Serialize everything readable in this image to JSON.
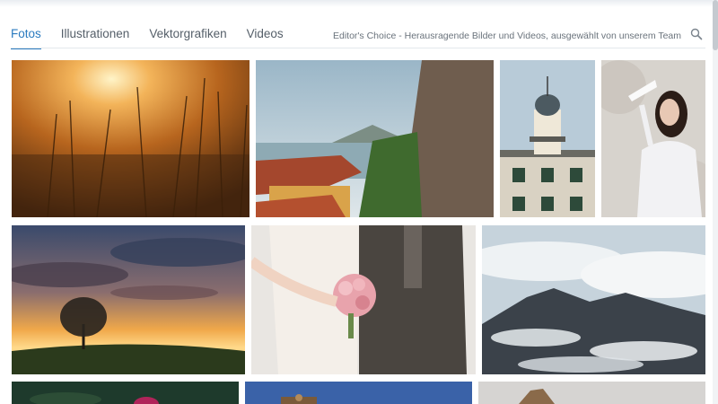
{
  "nav": {
    "tabs": [
      {
        "label": "Fotos",
        "active": true
      },
      {
        "label": "Illustrationen",
        "active": false
      },
      {
        "label": "Vektorgrafiken",
        "active": false
      },
      {
        "label": "Videos",
        "active": false
      }
    ],
    "editors_choice": "Editor's Choice - Herausragende Bilder und Videos, ausgewählt von unserem Team",
    "search_icon": "search-icon"
  },
  "colors": {
    "accent": "#2b7bbf",
    "text_muted": "#555f69"
  },
  "gallery": {
    "photos": [
      {
        "subject": "golden-grass-sunset"
      },
      {
        "subject": "lake-village-rooftops"
      },
      {
        "subject": "lighthouse-tower"
      },
      {
        "subject": "woman-with-feather"
      },
      {
        "subject": "lone-tree-sunset"
      },
      {
        "subject": "wedding-couple-bouquet"
      },
      {
        "subject": "mountains-above-clouds"
      },
      {
        "subject": "dark-flowers"
      },
      {
        "subject": "blue-sky-dome"
      },
      {
        "subject": "rock-formation"
      }
    ]
  }
}
